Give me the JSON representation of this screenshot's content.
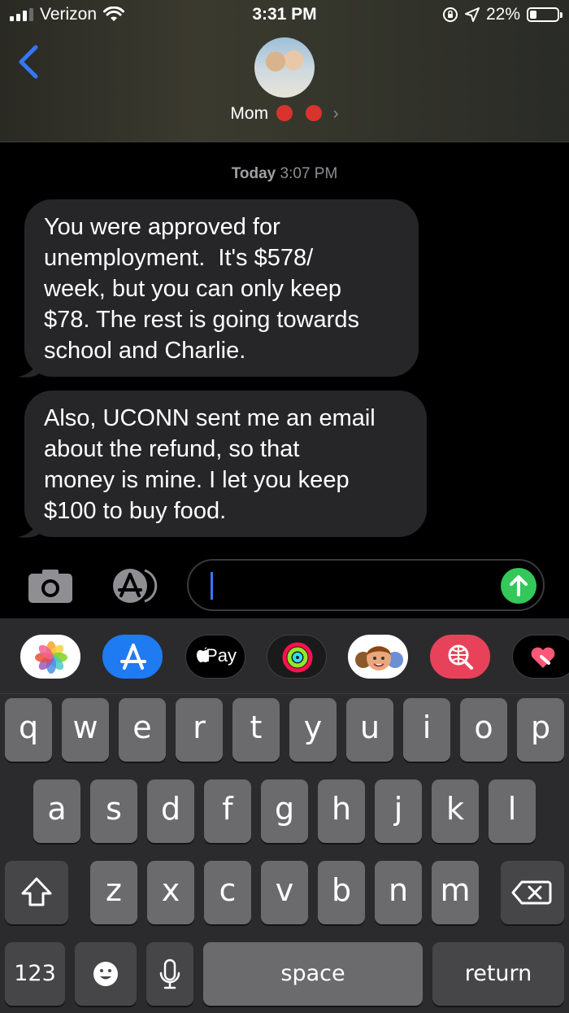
{
  "status_bar": {
    "carrier": "Verizon",
    "time": "3:31 PM",
    "battery": "22%",
    "battery_level": 0.22,
    "signal_bars_lit": 3
  },
  "header": {
    "contact_name": "Mom",
    "contact_emojis": [
      "devil-face-emoji",
      "devil-face-emoji"
    ]
  },
  "thread": {
    "timestamp_day": "Today",
    "timestamp_time": "3:07 PM",
    "messages": [
      {
        "lines": [
          "You were approved for",
          "unemployment.  It's $578/",
          "week, but you can only keep",
          "$78. The rest is going towards",
          "school and Charlie."
        ]
      },
      {
        "lines": [
          "Also, UCONN sent me an email",
          "about the refund, so that",
          "money is mine. I let you keep",
          "$100 to buy food."
        ]
      }
    ]
  },
  "composer": {
    "value": "",
    "send_color": "#34c759"
  },
  "app_strip": {
    "items": [
      "photos-app",
      "app-store-app",
      "apple-pay-app",
      "activity-app",
      "memoji-app",
      "search-images-app",
      "digital-touch-app"
    ],
    "apple_pay_label": " Pay"
  },
  "keyboard": {
    "row1": [
      "q",
      "w",
      "e",
      "r",
      "t",
      "y",
      "u",
      "i",
      "o",
      "p"
    ],
    "row2": [
      "a",
      "s",
      "d",
      "f",
      "g",
      "h",
      "j",
      "k",
      "l"
    ],
    "row3": [
      "z",
      "x",
      "c",
      "v",
      "b",
      "n",
      "m"
    ],
    "numbers_label": "123",
    "space_label": "space",
    "return_label": "return"
  },
  "colors": {
    "bubble_incoming": "#262628",
    "caret": "#3478f6",
    "back_chevron": "#3478f6"
  }
}
